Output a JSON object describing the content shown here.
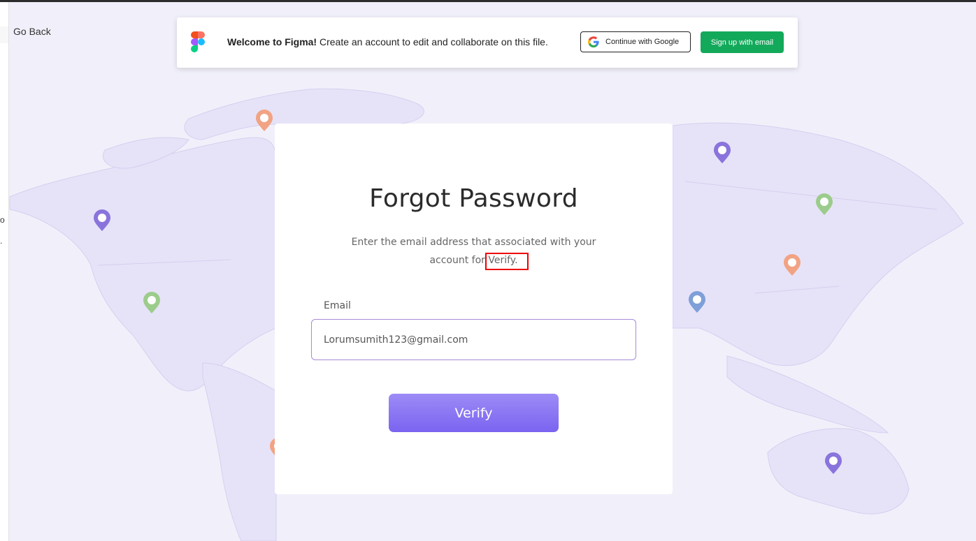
{
  "nav": {
    "go_back": "Go Back"
  },
  "edge_marks": {
    "top": "o",
    "bottom": "."
  },
  "banner": {
    "welcome_bold": "Welcome to Figma!",
    "welcome_text": " Create an account to edit and collaborate on this file.",
    "google_button": "Continue with Google",
    "email_button": "Sign up with email",
    "icons": [
      "figma-logo-icon",
      "google-icon"
    ]
  },
  "card": {
    "title": "Forgot Password",
    "subtitle_line1": "Enter the email address that associated with your",
    "subtitle_line2": "account for Verify.",
    "email_label": "Email",
    "email_value": "Lorumsumith123@gmail.com",
    "verify_button": "Verify"
  },
  "colors": {
    "background": "#f1f0fa",
    "map_fill": "#e6e3f8",
    "accent": "#7b63f0",
    "signup_green": "#13a95b",
    "pin_purple": "#8a74dc",
    "pin_orange": "#f2a383",
    "pin_green": "#9ccc8c",
    "pin_blue": "#7e9fd8",
    "highlight": "#ee0000"
  },
  "map_pins": [
    {
      "color": "orange",
      "icon": "map-pin-icon"
    },
    {
      "color": "purple",
      "icon": "map-pin-icon"
    },
    {
      "color": "purple",
      "icon": "map-pin-icon"
    },
    {
      "color": "green",
      "icon": "map-pin-icon"
    },
    {
      "color": "green",
      "icon": "map-pin-icon"
    },
    {
      "color": "orange",
      "icon": "map-pin-icon"
    },
    {
      "color": "blue",
      "icon": "map-pin-icon"
    },
    {
      "color": "purple",
      "icon": "map-pin-icon"
    },
    {
      "color": "orange",
      "icon": "map-pin-icon"
    }
  ]
}
